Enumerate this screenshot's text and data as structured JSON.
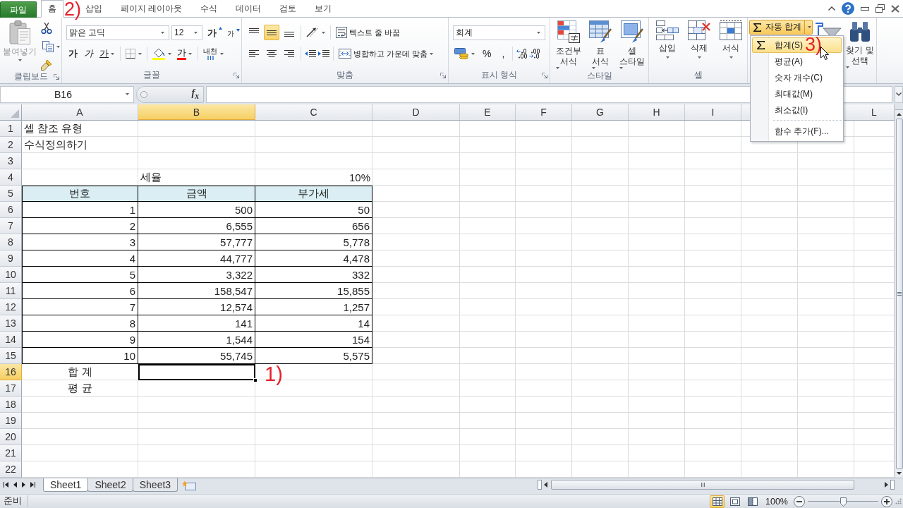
{
  "ribbon_tabs": {
    "file": "파일",
    "tabs": [
      {
        "label": "홈",
        "selected": true,
        "annotation": "2)"
      },
      {
        "label": "삽입",
        "selected": false
      },
      {
        "label": "페이지 레이아웃",
        "selected": false
      },
      {
        "label": "수식",
        "selected": false
      },
      {
        "label": "데이터",
        "selected": false
      },
      {
        "label": "검토",
        "selected": false
      },
      {
        "label": "보기",
        "selected": false
      }
    ]
  },
  "ribbon": {
    "clipboard": {
      "label": "클립보드",
      "paste": {
        "label": "붙여넣기",
        "disabled": true
      }
    },
    "font": {
      "label": "글꼴",
      "font_name": "맑은 고딕",
      "font_size": "12",
      "grow": "가",
      "shrink": "가",
      "styles": [
        {
          "kind": "bold",
          "label": "가"
        },
        {
          "kind": "italic",
          "label": "가"
        },
        {
          "kind": "underline",
          "label": "가"
        }
      ],
      "font_color": "가",
      "phonetic": "내천"
    },
    "alignment": {
      "label": "맞춤",
      "vertical": [
        {
          "kind": "top",
          "selected": false
        },
        {
          "kind": "middle",
          "selected": true
        },
        {
          "kind": "bottom",
          "selected": false
        }
      ],
      "horizontal": [
        {
          "kind": "left",
          "selected": false
        },
        {
          "kind": "center",
          "selected": false
        },
        {
          "kind": "right",
          "selected": false
        }
      ],
      "wrap_text": "텍스트 줄 바꿈",
      "merge_center": "병합하고 가운데 맞춤"
    },
    "number": {
      "label": "표시 형식",
      "format": "회계",
      "percent": "%",
      "comma": ","
    },
    "styles": {
      "label": "스타일",
      "buttons": [
        {
          "kind": "conditional",
          "lines": [
            "조건부",
            "서식"
          ]
        },
        {
          "kind": "table",
          "lines": [
            "표",
            "서식"
          ]
        },
        {
          "kind": "cell",
          "lines": [
            "셀",
            "스타일"
          ]
        }
      ]
    },
    "cells": {
      "label": "셀",
      "buttons": [
        {
          "kind": "insert",
          "label": "삽입"
        },
        {
          "kind": "delete",
          "label": "삭제"
        },
        {
          "kind": "format",
          "label": "서식"
        }
      ]
    },
    "editing": {
      "autosum": {
        "label": "자동 합계",
        "open": true
      },
      "find": {
        "lines": [
          "찾기 및",
          "선택"
        ]
      }
    }
  },
  "autosum_menu": {
    "items": [
      {
        "kind": "sum",
        "label": "합계(S)",
        "selected": true,
        "annotation": "3)"
      },
      {
        "kind": "average",
        "label": "평균(A)",
        "selected": false
      },
      {
        "kind": "count",
        "label": "숫자 개수(C)",
        "selected": false
      },
      {
        "kind": "max",
        "label": "최대값(M)",
        "selected": false
      },
      {
        "kind": "min",
        "label": "최소값(I)",
        "selected": false
      }
    ],
    "extra_items": [
      {
        "label": "함수 추가(F)...",
        "selected": false
      }
    ]
  },
  "formula_bar": {
    "name_box": "B16",
    "function_button": "f$_{x}$"
  },
  "sheet": {
    "columns": [
      {
        "label": "A",
        "selected": false
      },
      {
        "label": "B",
        "selected": true
      },
      {
        "label": "C",
        "selected": false
      },
      {
        "label": "D",
        "selected": false
      },
      {
        "label": "E",
        "selected": false
      },
      {
        "label": "F",
        "selected": false
      },
      {
        "label": "G",
        "selected": false
      },
      {
        "label": "H",
        "selected": false
      },
      {
        "label": "I",
        "selected": false
      },
      {
        "label": "L",
        "selected": false
      }
    ],
    "rows": [
      {
        "label": "1",
        "selected": false,
        "kind": "text",
        "cells": {
          "a": "셀 참조 유형"
        }
      },
      {
        "label": "2",
        "selected": false,
        "kind": "text",
        "cells": {
          "a": "수식정의하기"
        }
      },
      {
        "label": "3",
        "selected": false,
        "kind": "empty"
      },
      {
        "label": "4",
        "selected": false,
        "kind": "rate",
        "cells": {
          "b": "세율",
          "c": "10%"
        }
      },
      {
        "label": "5",
        "selected": false,
        "kind": "header",
        "cells": {
          "a": "번호",
          "b": "금액",
          "c": "부가세"
        }
      },
      {
        "label": "6",
        "selected": false,
        "kind": "data",
        "cells": {
          "a": "1",
          "b": "500",
          "c": "50"
        }
      },
      {
        "label": "7",
        "selected": false,
        "kind": "data",
        "cells": {
          "a": "2",
          "b": "6,555",
          "c": "656"
        }
      },
      {
        "label": "8",
        "selected": false,
        "kind": "data",
        "cells": {
          "a": "3",
          "b": "57,777",
          "c": "5,778"
        }
      },
      {
        "label": "9",
        "selected": false,
        "kind": "data",
        "cells": {
          "a": "4",
          "b": "44,777",
          "c": "4,478"
        }
      },
      {
        "label": "10",
        "selected": false,
        "kind": "data",
        "cells": {
          "a": "5",
          "b": "3,322",
          "c": "332"
        }
      },
      {
        "label": "11",
        "selected": false,
        "kind": "data",
        "cells": {
          "a": "6",
          "b": "158,547",
          "c": "15,855"
        }
      },
      {
        "label": "12",
        "selected": false,
        "kind": "data",
        "cells": {
          "a": "7",
          "b": "12,574",
          "c": "1,257"
        }
      },
      {
        "label": "13",
        "selected": false,
        "kind": "data",
        "cells": {
          "a": "8",
          "b": "141",
          "c": "14"
        }
      },
      {
        "label": "14",
        "selected": false,
        "kind": "data",
        "cells": {
          "a": "9",
          "b": "1,544",
          "c": "154"
        }
      },
      {
        "label": "15",
        "selected": false,
        "kind": "data",
        "cells": {
          "a": "10",
          "b": "55,745",
          "c": "5,575"
        }
      },
      {
        "label": "16",
        "selected": true,
        "kind": "label",
        "cells": {
          "a": "합 계"
        },
        "annotation": "1)"
      },
      {
        "label": "17",
        "selected": false,
        "kind": "label",
        "cells": {
          "a": "평 균"
        }
      },
      {
        "label": "18",
        "selected": false,
        "kind": "empty"
      },
      {
        "label": "19",
        "selected": false,
        "kind": "empty"
      },
      {
        "label": "20",
        "selected": false,
        "kind": "empty"
      },
      {
        "label": "21",
        "selected": false,
        "kind": "empty"
      },
      {
        "label": "22",
        "selected": false,
        "kind": "empty"
      }
    ]
  },
  "sheet_tabs": [
    {
      "label": "Sheet1",
      "selected": true
    },
    {
      "label": "Sheet2",
      "selected": false
    },
    {
      "label": "Sheet3",
      "selected": false
    }
  ],
  "status_bar": {
    "status": "준비",
    "views": [
      {
        "kind": "normal",
        "selected": true
      },
      {
        "kind": "page_layout",
        "selected": false
      },
      {
        "kind": "page_break",
        "selected": false
      }
    ],
    "zoom": "100%",
    "zoom_slider": {
      "level": 0.5
    }
  }
}
